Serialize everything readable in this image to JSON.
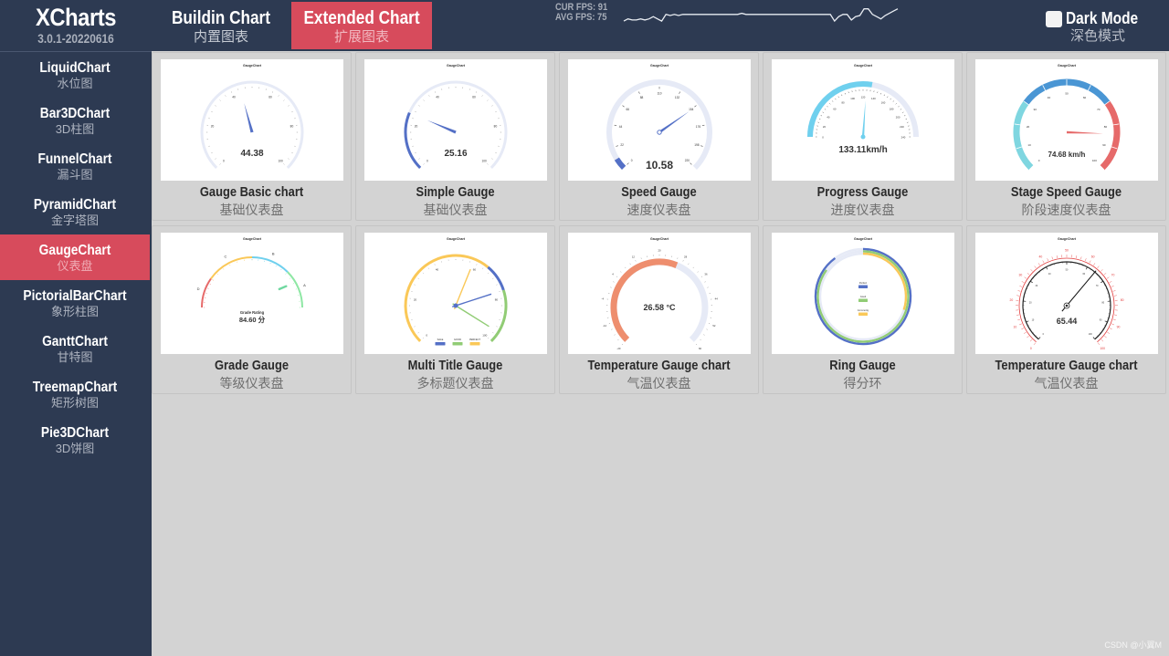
{
  "app": {
    "name": "XCharts",
    "version": "3.0.1-20220616"
  },
  "top_tabs": [
    {
      "en": "Buildin Chart",
      "zh": "内置图表",
      "active": false
    },
    {
      "en": "Extended Chart",
      "zh": "扩展图表",
      "active": true
    }
  ],
  "fps": {
    "cur_label": "CUR FPS: 91",
    "avg_label": "AVG FPS: 75",
    "history": [
      72,
      74,
      73,
      73,
      74,
      73,
      74,
      76,
      74,
      72,
      78,
      77,
      78,
      77,
      78,
      78,
      78,
      78,
      78,
      78,
      78,
      78,
      78,
      78,
      78,
      78,
      78,
      78,
      79,
      78,
      78,
      78,
      78,
      78,
      78,
      78,
      78,
      78,
      78,
      78,
      78,
      78,
      78,
      78,
      78,
      78,
      78,
      78,
      78,
      78,
      72,
      76,
      78,
      78,
      73,
      76,
      77,
      83,
      83,
      78,
      76,
      74,
      77,
      79,
      81,
      83
    ]
  },
  "dark_mode": {
    "label": "Dark Mode",
    "sub": "深色模式",
    "checked": false
  },
  "sidebar": {
    "items": [
      {
        "en": "LiquidChart",
        "zh": "水位图",
        "active": false
      },
      {
        "en": "Bar3DChart",
        "zh": "3D柱图",
        "active": false
      },
      {
        "en": "FunnelChart",
        "zh": "漏斗图",
        "active": false
      },
      {
        "en": "PyramidChart",
        "zh": "金字塔图",
        "active": false
      },
      {
        "en": "GaugeChart",
        "zh": "仪表盘",
        "active": true
      },
      {
        "en": "PictorialBarChart",
        "zh": "象形柱图",
        "active": false
      },
      {
        "en": "GanttChart",
        "zh": "甘特图",
        "active": false
      },
      {
        "en": "TreemapChart",
        "zh": "矩形树图",
        "active": false
      },
      {
        "en": "Pie3DChart",
        "zh": "3D饼图",
        "active": false
      }
    ]
  },
  "cards": [
    {
      "title": "Gauge Basic chart",
      "sub": "基础仪表盘",
      "chart_title": "GaugeChart",
      "value_text": "44.38",
      "type": "basic",
      "value": 44.38,
      "min": 0,
      "max": 100
    },
    {
      "title": "Simple Gauge",
      "sub": "基础仪表盘",
      "chart_title": "GaugeChart",
      "value_text": "25.16",
      "type": "simple",
      "value": 25.16,
      "min": 0,
      "max": 100
    },
    {
      "title": "Speed Gauge",
      "sub": "速度仪表盘",
      "chart_title": "GaugeChart",
      "value_text": "10.58",
      "type": "speed",
      "value": 10.58,
      "min": 0,
      "max": 220
    },
    {
      "title": "Progress Gauge",
      "sub": "进度仪表盘",
      "chart_title": "GaugeChart",
      "value_text": "133.11km/h",
      "type": "progress",
      "value": 133.11,
      "min": 0,
      "max": 240
    },
    {
      "title": "Stage Speed Gauge",
      "sub": "阶段速度仪表盘",
      "chart_title": "GaugeChart",
      "value_text": "74.68 km/h",
      "type": "stage",
      "value": 74.68,
      "min": 0,
      "max": 100
    },
    {
      "title": "Grade Gauge",
      "sub": "等级仪表盘",
      "chart_title": "GaugeChart",
      "value_label": "Grade Rating",
      "value_text": "84.60 分",
      "type": "grade",
      "value": 84.6,
      "min": 0,
      "max": 100,
      "grades": [
        "D",
        "C",
        "B",
        "A"
      ]
    },
    {
      "title": "Multi Title Gauge",
      "sub": "多标题仪表盘",
      "chart_title": "GaugeChart",
      "type": "multi",
      "min": 0,
      "max": 100,
      "pointers": [
        {
          "name": "SALE",
          "value": 72
        },
        {
          "name": "GOOD",
          "value": 34
        },
        {
          "name": "PERFECT",
          "value": 55
        }
      ]
    },
    {
      "title": "Temperature Gauge chart",
      "sub": "气温仪表盘",
      "chart_title": "GaugeChart",
      "value_text": "26.58 °C",
      "type": "temperature",
      "value": 26.58,
      "min": -20,
      "max": 60
    },
    {
      "title": "Ring Gauge",
      "sub": "得分环",
      "chart_title": "GaugeChart",
      "type": "ring",
      "rings": [
        {
          "name": "Perfect",
          "value": 90
        },
        {
          "name": "Good",
          "value": 85
        },
        {
          "name": "Commonly",
          "value": 30
        }
      ]
    },
    {
      "title": "Temperature Gauge chart",
      "sub": "气温仪表盘",
      "chart_title": "GaugeChart",
      "value_text": "65.44",
      "type": "thermo",
      "value": 65.44,
      "min": 0,
      "max": 100
    }
  ],
  "colors": {
    "header_bg": "#2d3a52",
    "accent": "#d74b5c",
    "content_bg": "#d3d3d3",
    "gauge_blue": "#5470c6",
    "gauge_track": "#e6eaf6",
    "gauge_cyan": "#6fd0ee",
    "gauge_red": "#e66a6a",
    "gauge_green": "#91cc75",
    "gauge_yellow": "#fac858",
    "gauge_orange": "#ee8e6e"
  },
  "watermark": "CSDN @小翼M"
}
